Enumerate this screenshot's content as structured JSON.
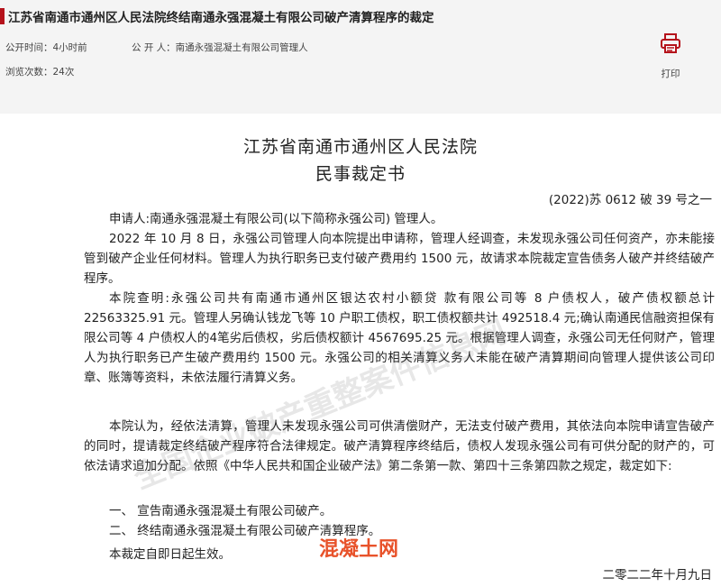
{
  "header": {
    "title": "江苏省南通市通州区人民法院终结南通永强混凝土有限公司破产清算程序的裁定",
    "publish_time": "公开时间：4小时前",
    "publisher": "公 开 人：南通永强混凝土有限公司管理人",
    "views": "浏览次数：24次",
    "print_label": "打印"
  },
  "document": {
    "court_name": "江苏省南通市通州区人民法院",
    "doc_type": "民事裁定书",
    "case_number": "(2022)苏 0612 破 39 号之一",
    "paragraphs": [
      "申请人:南通永强混凝土有限公司(以下简称永强公司) 管理人。",
      "2022 年 10 月 8 日，永强公司管理人向本院提出申请称，管理人经调查，未发现永强公司任何资产，亦未能接管到破产企业任何材料。管理人为执行职务已支付破产费用约 1500 元，故请求本院裁定宣告债务人破产并终结破产程序。",
      "本院查明:永强公司共有南通市通州区银达农村小额贷 款有限公司等 8 户债权人，破产债权额总计 22563325.91 元。管理人另确认钱龙飞等 10 户职工债权，职工债权额共计 492518.4 元;确认南通民信融资担保有限公司等 4 户债权人的4笔劣后债权，劣后债权额计 4567695.25 元。根据管理人调查，永强公司无任何财产，管理人为执行职务已产生破产费用约 1500 元。永强公司的相关清算义务人未能在破产清算期间向管理人提供该公司印章、账簿等资料，未依法履行清算义务。",
      "本院认为，经依法清算，管理人未发现永强公司可供清偿财产，无法支付破产费用，其依法向本院申请宣告破产的同时，提请裁定终结破产程序符合法律规定。破产清算程序终结后，债权人发现永强公司有可供分配的财产的，可依法请求追加分配。依照《中华人民共和国企业破产法》第二条第一款、第四十三条第四款之规定，裁定如下:",
      "一、 宣告南通永强混凝土有限公司破产。",
      "二、 终结南通永强混凝土有限公司破产清算程序。",
      "本裁定自即日起生效。"
    ],
    "sign_date": "二零二二年十月九日"
  },
  "watermark": "全国企业破产重整案件信息网",
  "site_mark": "混凝土网",
  "colors": {
    "accent": "#b5121b",
    "header_bg": "#f4f4f4",
    "site_mark": "#e8522a"
  },
  "icons": {
    "print": "printer-icon"
  }
}
